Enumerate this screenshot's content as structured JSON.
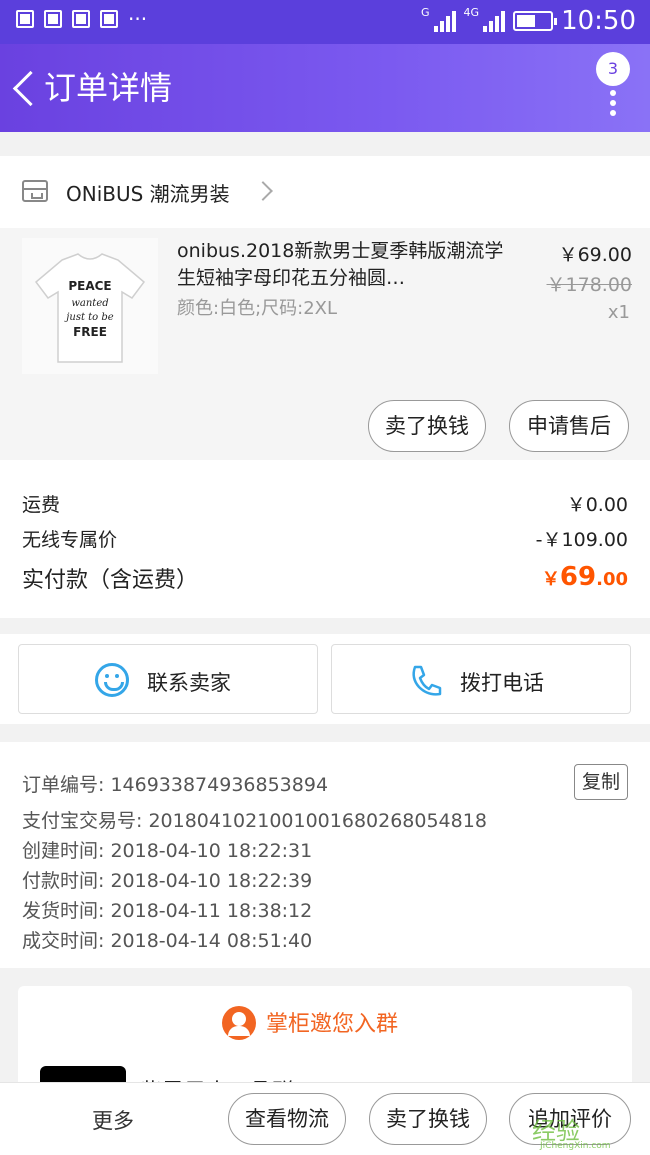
{
  "status_bar": {
    "network": "4G",
    "carrier_g": "G",
    "time": "10:50"
  },
  "header": {
    "title": "订单详情",
    "badge_count": "3"
  },
  "shop": {
    "name": "ONiBUS 潮流男装"
  },
  "product": {
    "title": "onibus.2018新款男士夏季韩版潮流学生短袖字母印花五分袖圆…",
    "sku": "颜色:白色;尺码:2XL",
    "price": "￥69.00",
    "original_price": "￥178.00",
    "quantity": "x1",
    "shirt_print": [
      "PEACE",
      "wanted",
      "just to be",
      "FREE"
    ],
    "actions": [
      "卖了换钱",
      "申请售后"
    ]
  },
  "totals": {
    "shipping_label": "运费",
    "shipping_value": "￥0.00",
    "discount_label": "无线专属价",
    "discount_value": "-￥109.00",
    "paid_label": "实付款（含运费）",
    "paid_currency": "￥",
    "paid_integer": "69",
    "paid_decimal": ".00"
  },
  "contact": {
    "seller_label": "联系卖家",
    "call_label": "拨打电话"
  },
  "order_info": {
    "copy_label": "复制",
    "lines": [
      "订单编号: 146933874936853894",
      "支付宝交易号: 2018041021001001680268054818",
      "创建时间: 2018-04-10 18:22:31",
      "付款时间: 2018-04-10 18:22:39",
      "发货时间: 2018-04-11 18:38:12",
      "成交时间: 2018-04-14 08:51:40"
    ]
  },
  "group": {
    "title": "掌柜邀您入群",
    "name": "紫灵男人 | 品群"
  },
  "bottom_bar": {
    "more": "更多",
    "logistics": "查看物流",
    "sell": "卖了换钱",
    "review": "追加评价"
  },
  "watermark": {
    "logo": "经验",
    "url": "JiChengXin.com"
  },
  "colors": {
    "header": "#6a41e0",
    "accent_price": "#ff5500",
    "group": "#f26522",
    "chat": "#34a6e8"
  }
}
